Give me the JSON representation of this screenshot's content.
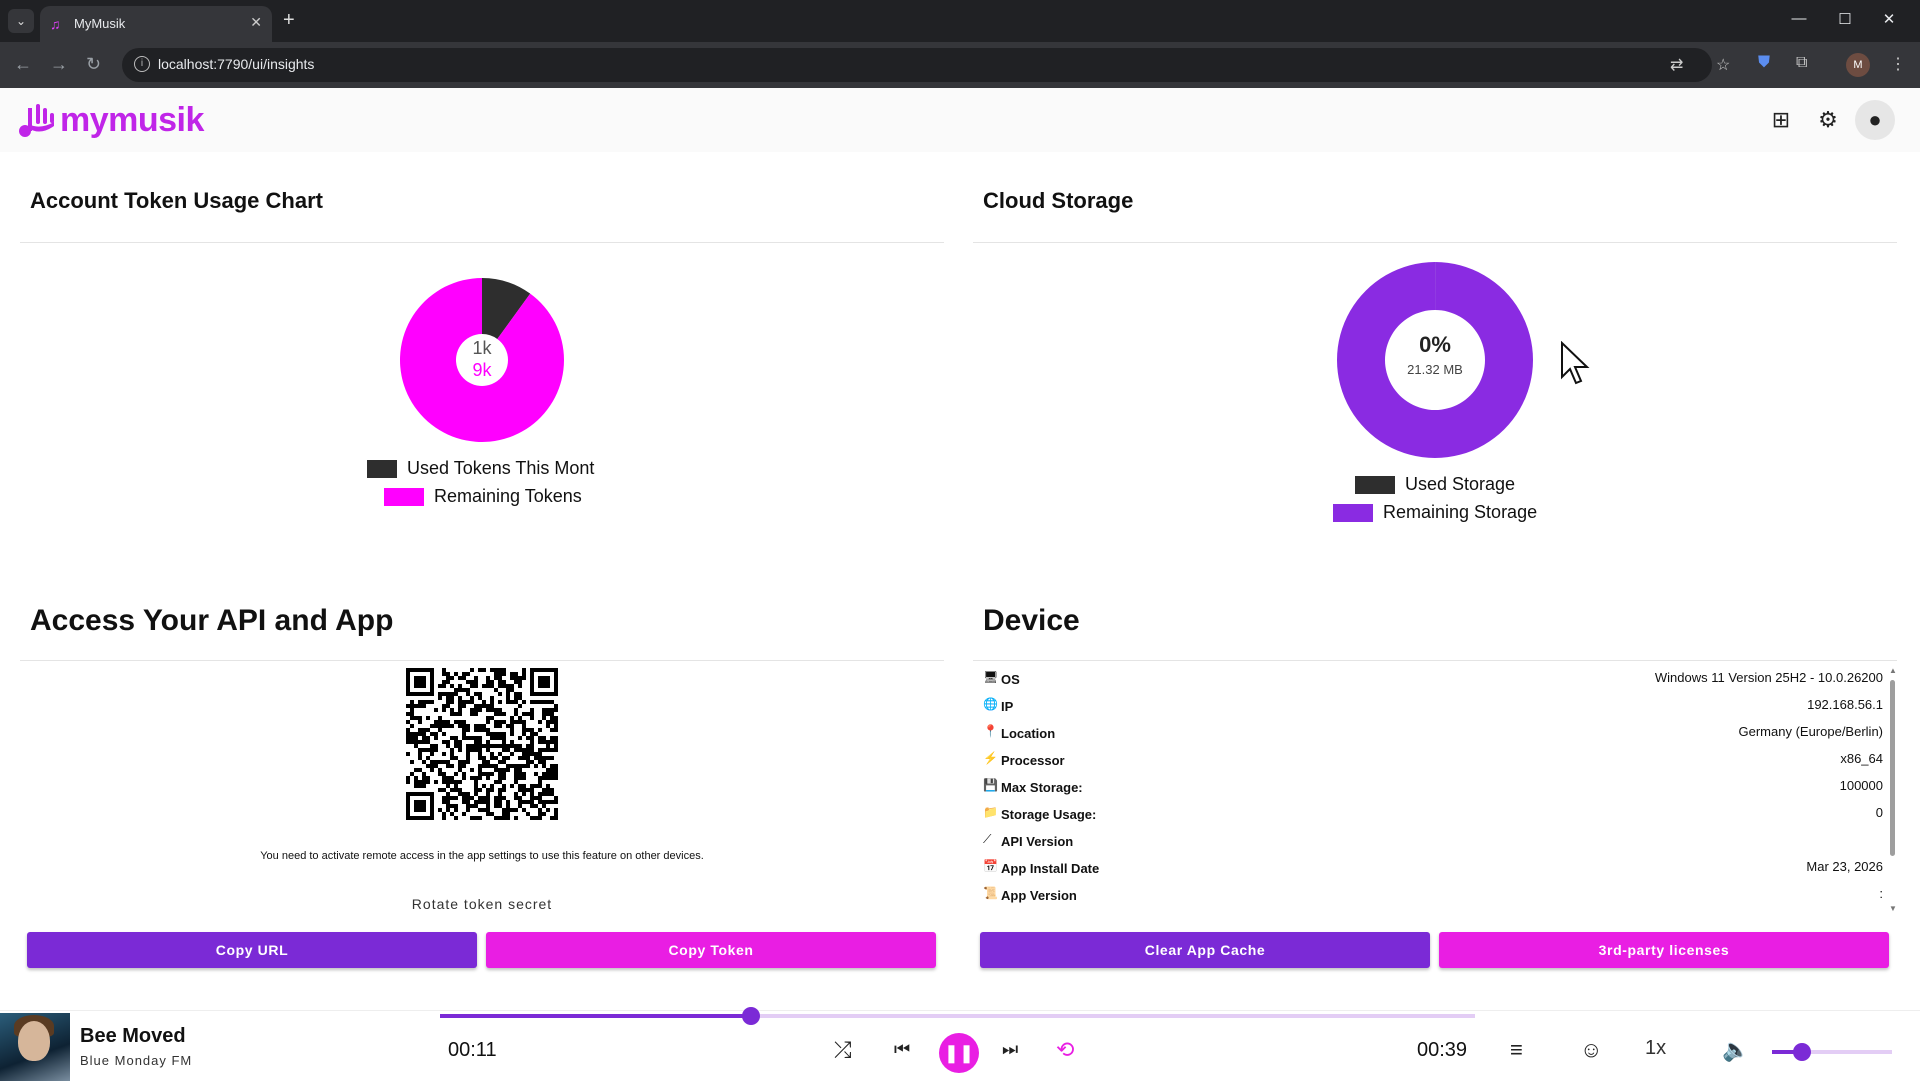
{
  "browser": {
    "tab_title": "MyMusik",
    "url": "localhost:7790/ui/insights",
    "profile_initial": "M"
  },
  "app": {
    "logo_text": "mymusik",
    "accent": "#c025e8",
    "primary": "#7b2ad6",
    "secondary": "#e91ee3"
  },
  "token_card": {
    "title": "Account Token Usage Chart",
    "center_used": "1k",
    "center_remaining": "9k",
    "legend_used": "Used Tokens This Mont",
    "legend_remaining": "Remaining Tokens"
  },
  "storage_card": {
    "title": "Cloud Storage",
    "center_percent": "0%",
    "center_size": "21.32 MB",
    "legend_used": "Used Storage",
    "legend_remaining": "Remaining Storage"
  },
  "chart_data": [
    {
      "type": "pie",
      "categories": [
        "Used Tokens This Mont",
        "Remaining Tokens"
      ],
      "values": [
        1000,
        9000
      ],
      "colors": [
        "#2e2e2e",
        "#ff00ff"
      ],
      "title": "Account Token Usage Chart",
      "donut": true,
      "legend": "bottom"
    },
    {
      "type": "pie",
      "categories": [
        "Used Storage",
        "Remaining Storage"
      ],
      "values": [
        21.32,
        99978.68
      ],
      "colors": [
        "#2e2e2e",
        "#8a2be2"
      ],
      "title": "Cloud Storage",
      "donut": true,
      "legend": "bottom"
    }
  ],
  "api_card": {
    "title": "Access Your API and App",
    "notice": "You need to activate remote access in the app settings to use this feature on other devices.",
    "rotate_label": "Rotate token secret",
    "copy_url": "Copy URL",
    "copy_token": "Copy Token"
  },
  "device_card": {
    "title": "Device",
    "rows": [
      {
        "label": "OS",
        "value": "Windows 11 Version 25H2 - 10.0.26200",
        "icon": "monitor-icon"
      },
      {
        "label": "IP",
        "value": "192.168.56.1",
        "icon": "globe-icon"
      },
      {
        "label": "Location",
        "value": "Germany (Europe/Berlin)",
        "icon": "pin-icon"
      },
      {
        "label": "Processor",
        "value": "x86_64",
        "icon": "lightning-icon"
      },
      {
        "label": "Max Storage:",
        "value": "100000",
        "icon": "floppy-icon"
      },
      {
        "label": "Storage Usage:",
        "value": "0",
        "icon": "folder-icon"
      },
      {
        "label": "API Version",
        "value": "",
        "icon": "link-icon"
      },
      {
        "label": "App Install Date",
        "value": "Mar 23, 2026",
        "icon": "calendar-icon"
      },
      {
        "label": "App Version",
        "value": ":",
        "icon": "scroll-icon"
      }
    ],
    "clear_cache": "Clear App Cache",
    "licenses": "3rd-party licenses"
  },
  "player": {
    "title": "Bee Moved",
    "artist": "Blue Monday FM",
    "elapsed": "00:11",
    "duration": "00:39",
    "progress": 0.3,
    "speed": "1x",
    "volume": 0.25
  }
}
